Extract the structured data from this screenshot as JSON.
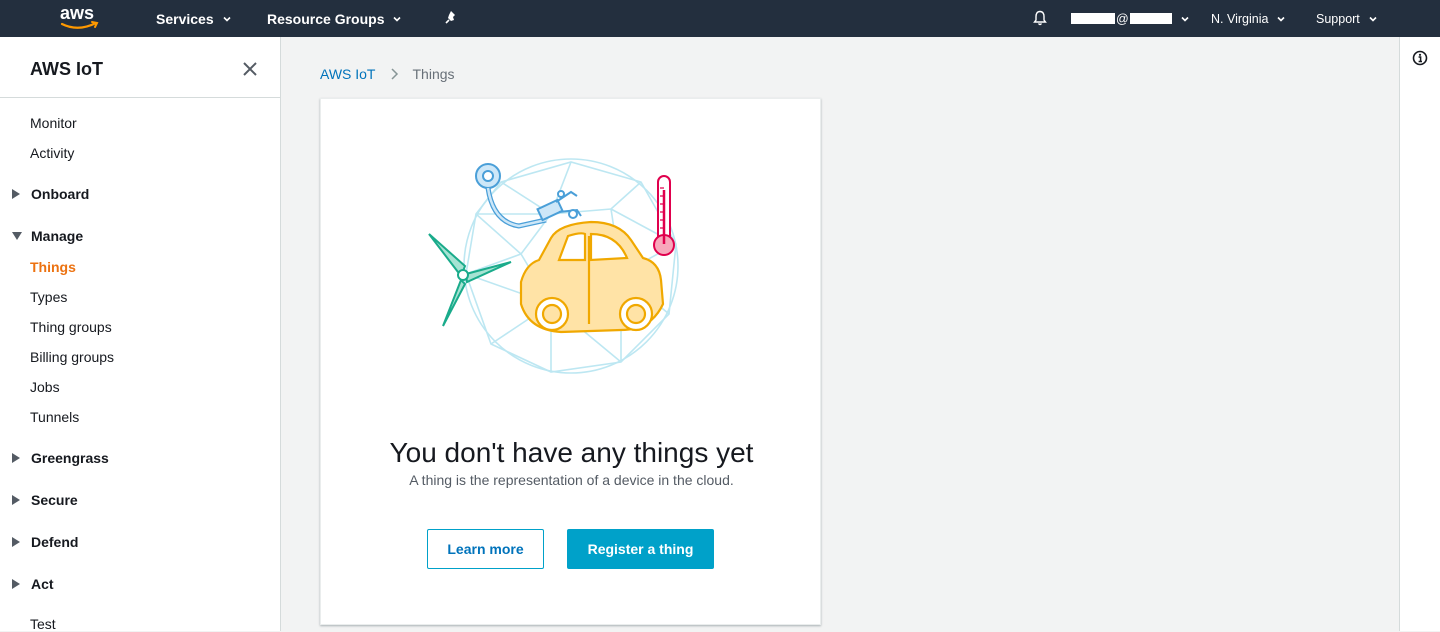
{
  "topnav": {
    "logo": "aws",
    "services_label": "Services",
    "resource_groups_label": "Resource Groups",
    "account_separator": "@",
    "region_label": "N. Virginia",
    "support_label": "Support",
    "icons": [
      "pin-icon",
      "bell-icon",
      "chevron-down-icon"
    ]
  },
  "sidebar": {
    "title": "AWS IoT",
    "items": {
      "monitor": "Monitor",
      "activity": "Activity",
      "onboard": "Onboard",
      "manage": "Manage",
      "things": "Things",
      "types": "Types",
      "thing_groups": "Thing groups",
      "billing_groups": "Billing groups",
      "jobs": "Jobs",
      "tunnels": "Tunnels",
      "greengrass": "Greengrass",
      "secure": "Secure",
      "defend": "Defend",
      "act": "Act",
      "test": "Test"
    }
  },
  "breadcrumb": {
    "root": "AWS IoT",
    "current": "Things"
  },
  "empty_state": {
    "title": "You don't have any things yet",
    "subtitle": "A thing is the representation of a device in the cloud.",
    "learn_more_label": "Learn more",
    "register_label": "Register a thing"
  },
  "colors": {
    "nav_bg": "#232f3e",
    "accent_orange": "#ec7211",
    "link_blue": "#0073bb",
    "primary_button": "#00a1c9"
  }
}
